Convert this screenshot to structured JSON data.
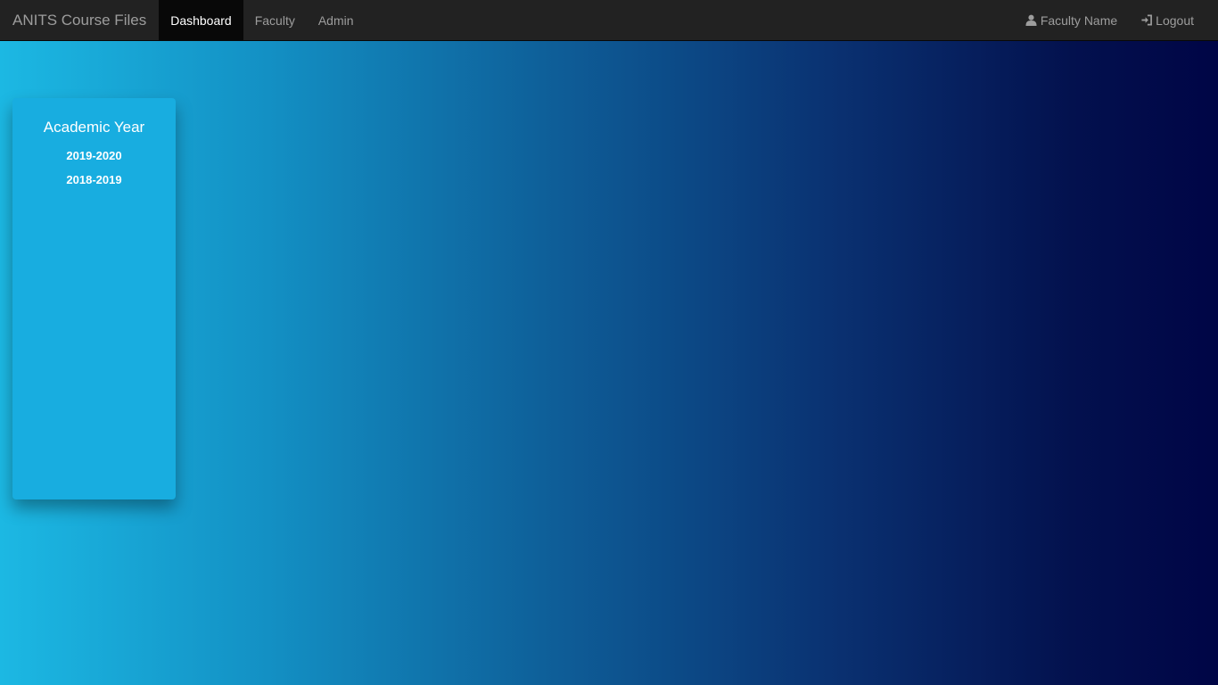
{
  "navbar": {
    "brand": "ANITS Course Files",
    "links": [
      {
        "label": "Dashboard",
        "active": true
      },
      {
        "label": "Faculty",
        "active": false
      },
      {
        "label": "Admin",
        "active": false
      }
    ],
    "user": {
      "icon": "user-icon",
      "label": "Faculty Name"
    },
    "logout": {
      "icon": "logout-icon",
      "label": "Logout"
    }
  },
  "sidebar": {
    "title": "Academic Year",
    "years": [
      "2019-2020",
      "2018-2019"
    ]
  },
  "colors": {
    "navbar_bg": "#222222",
    "active_tab_bg": "#080808",
    "card_bg": "#18ade0",
    "gradient_start": "#1cb8e3",
    "gradient_end": "#000546"
  }
}
